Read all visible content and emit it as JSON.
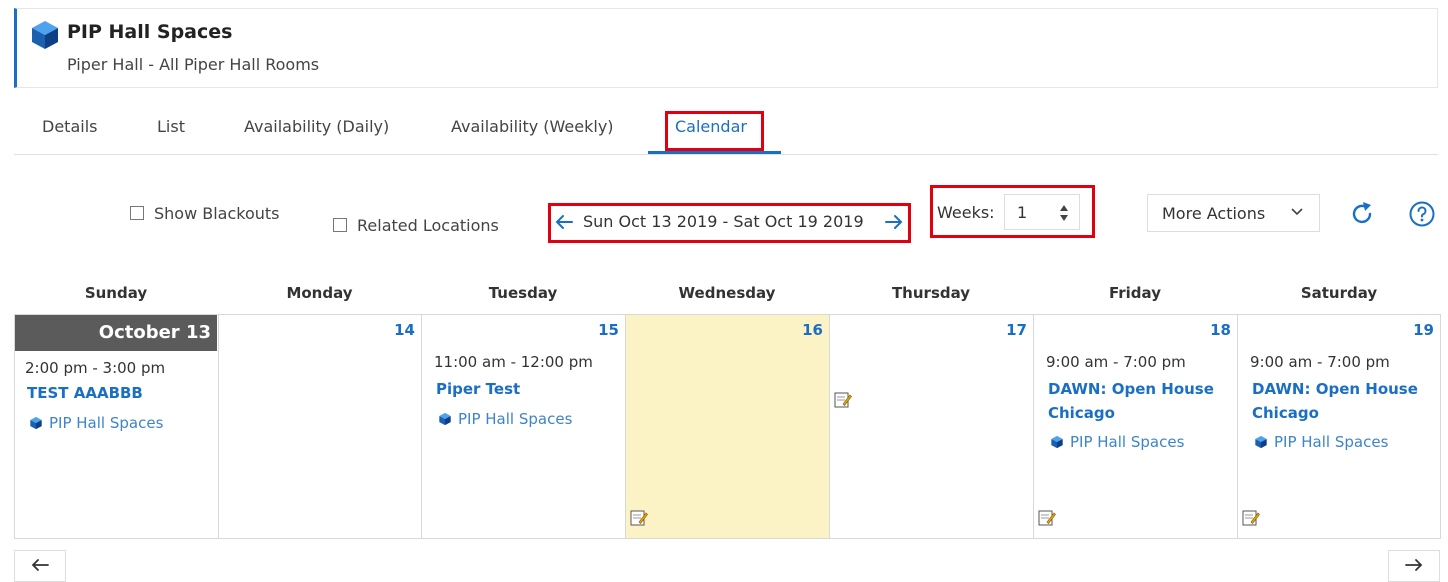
{
  "header": {
    "title": "PIP Hall Spaces",
    "subtitle": "Piper Hall - All Piper Hall Rooms"
  },
  "tabs": [
    {
      "label": "Details"
    },
    {
      "label": "List"
    },
    {
      "label": "Availability (Daily)"
    },
    {
      "label": "Availability (Weekly)"
    },
    {
      "label": "Calendar",
      "active": true
    }
  ],
  "toolbar": {
    "show_blackouts": "Show Blackouts",
    "related_locations": "Related Locations",
    "date_range": "Sun Oct 13 2019 - Sat Oct 19 2019",
    "weeks_label": "Weeks:",
    "weeks_value": "1",
    "more_actions": "More Actions"
  },
  "calendar": {
    "weekdays": [
      "Sunday",
      "Monday",
      "Tuesday",
      "Wednesday",
      "Thursday",
      "Friday",
      "Saturday"
    ],
    "days": [
      {
        "num": "October 13",
        "event": {
          "time": "2:00 pm - 3:00 pm",
          "title": "TEST AAABBB",
          "location": "PIP Hall Spaces"
        }
      },
      {
        "num": "14"
      },
      {
        "num": "15",
        "event": {
          "time": "11:00 am - 12:00 pm",
          "title": "Piper Test",
          "location": "PIP Hall Spaces"
        }
      },
      {
        "num": "16",
        "today": true
      },
      {
        "num": "17"
      },
      {
        "num": "18",
        "event": {
          "time": "9:00 am - 7:00 pm",
          "title": "DAWN: Open House Chicago",
          "location": "PIP Hall Spaces"
        }
      },
      {
        "num": "19",
        "event": {
          "time": "9:00 am - 7:00 pm",
          "title": "DAWN: Open House Chicago",
          "location": "PIP Hall Spaces"
        }
      }
    ]
  },
  "colors": {
    "accent": "#1a6fc4",
    "highlight_box": "#e0000f",
    "today_bg": "#fbf3c6",
    "month_banner": "#5b5b5b"
  },
  "icons": {
    "location": "cube-icon",
    "refresh": "refresh-icon",
    "help": "help-icon",
    "edit": "edit-note-icon"
  }
}
